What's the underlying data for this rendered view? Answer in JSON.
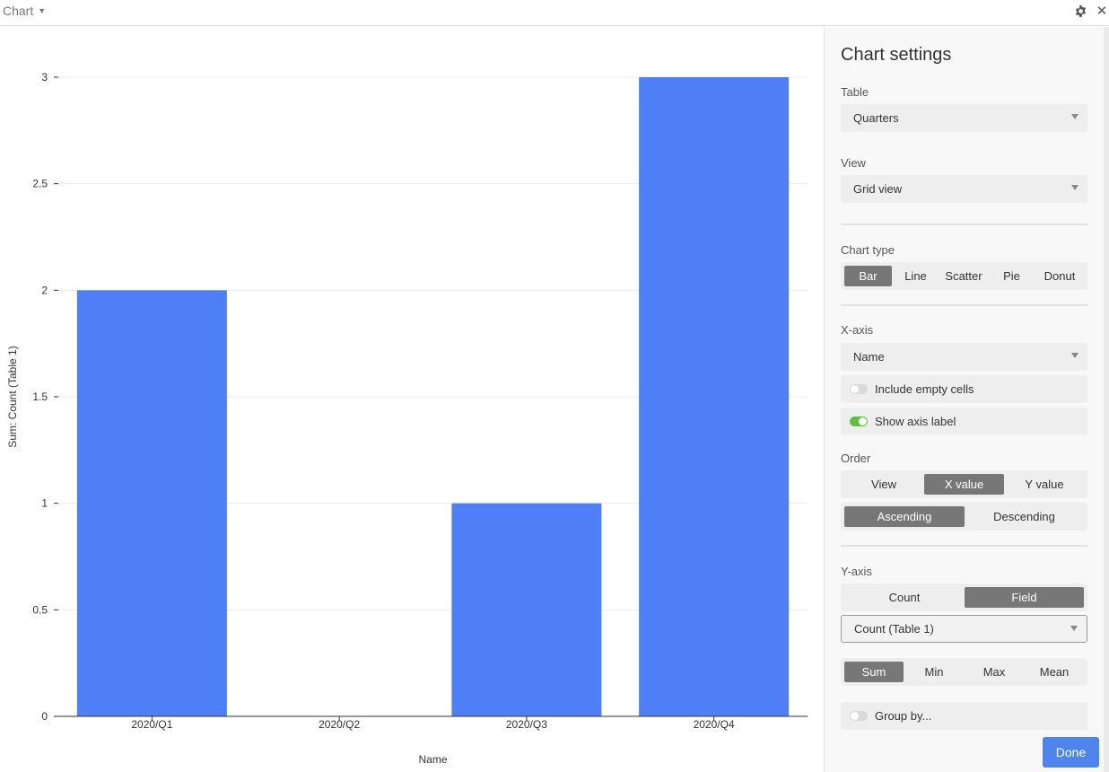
{
  "app": {
    "title": "Chart"
  },
  "icons": {
    "gear": "gear-icon",
    "close": "close-icon",
    "caret": "caret-down-icon"
  },
  "colors": {
    "bar": "#4f7ff7",
    "accent": "#4d84ee",
    "toggle_on": "#5fbf3f",
    "active_segment": "#777777"
  },
  "chart_data": {
    "type": "bar",
    "categories": [
      "2020/Q1",
      "2020/Q2",
      "2020/Q3",
      "2020/Q4"
    ],
    "values": [
      2,
      0,
      1,
      3
    ],
    "xlabel": "Name",
    "ylabel": "Sum: Count (Table 1)",
    "ylim": [
      0,
      3
    ],
    "yticks": [
      "0",
      "0.5",
      "1",
      "1.5",
      "2",
      "2.5",
      "3"
    ],
    "grid": true
  },
  "settings": {
    "title": "Chart settings",
    "table": {
      "label": "Table",
      "value": "Quarters"
    },
    "view": {
      "label": "View",
      "value": "Grid view"
    },
    "chart_type": {
      "label": "Chart type",
      "options": [
        "Bar",
        "Line",
        "Scatter",
        "Pie",
        "Donut"
      ],
      "selected": "Bar"
    },
    "x_axis": {
      "label": "X-axis",
      "field": "Name",
      "include_empty": {
        "label": "Include empty cells",
        "on": false
      },
      "show_axis_label": {
        "label": "Show axis label",
        "on": true
      }
    },
    "order": {
      "label": "Order",
      "by_options": [
        "View",
        "X value",
        "Y value"
      ],
      "by_selected": "X value",
      "direction_options": [
        "Ascending",
        "Descending"
      ],
      "direction_selected": "Ascending"
    },
    "y_axis": {
      "label": "Y-axis",
      "mode_options": [
        "Count",
        "Field"
      ],
      "mode_selected": "Field",
      "field": "Count (Table 1)",
      "aggregate_options": [
        "Sum",
        "Min",
        "Max",
        "Mean"
      ],
      "aggregate_selected": "Sum",
      "group_by": {
        "label": "Group by...",
        "on": false
      }
    },
    "done_label": "Done"
  }
}
